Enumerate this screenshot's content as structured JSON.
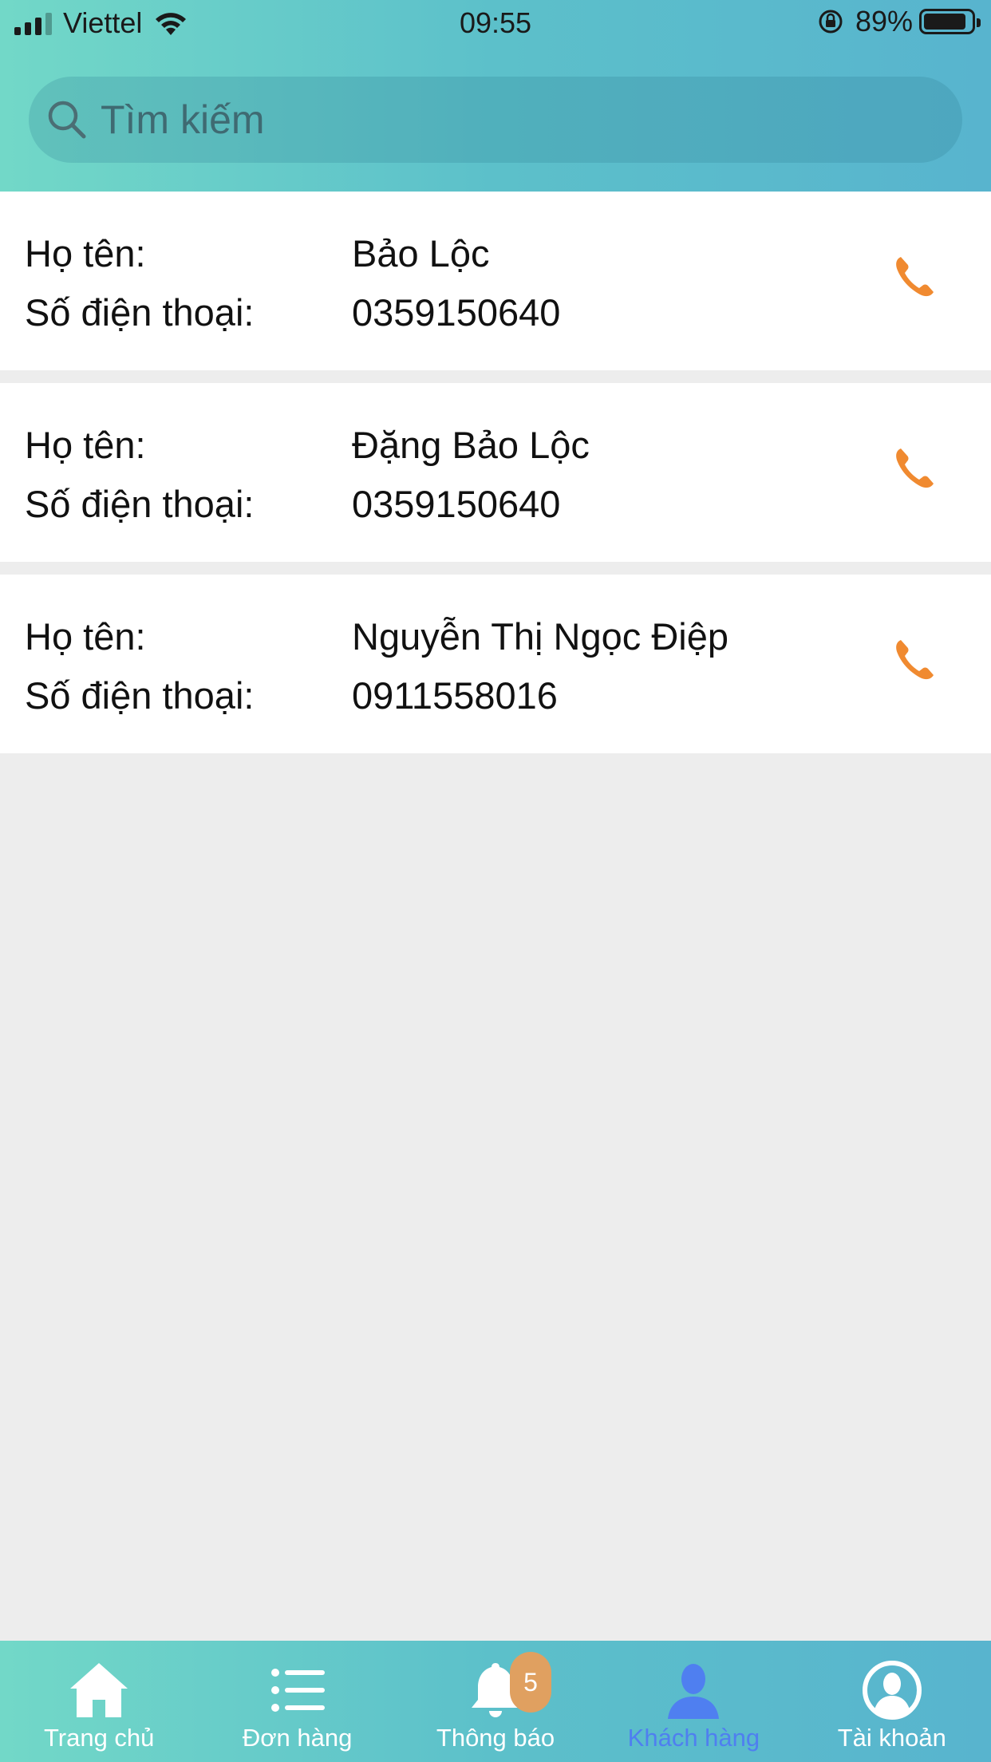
{
  "status_bar": {
    "carrier": "Viettel",
    "time": "09:55",
    "battery": "89%",
    "battery_level": 0.89
  },
  "search": {
    "placeholder": "Tìm kiếm",
    "value": ""
  },
  "customers": [
    {
      "name_label": "Họ tên:",
      "name": "Bảo Lộc",
      "phone_label": "Số điện thoại:",
      "phone": "0359150640"
    },
    {
      "name_label": "Họ tên:",
      "name": "Đặng Bảo Lộc",
      "phone_label": "Số điện thoại:",
      "phone": "0359150640"
    },
    {
      "name_label": "Họ tên:",
      "name": "Nguyễn Thị Ngọc Điệp",
      "phone_label": "Số điện thoại:",
      "phone": "0911558016"
    }
  ],
  "tabs": [
    {
      "label": "Trang chủ",
      "icon": "home-icon"
    },
    {
      "label": "Đơn hàng",
      "icon": "list-icon"
    },
    {
      "label": "Thông báo",
      "icon": "bell-icon",
      "badge": "5"
    },
    {
      "label": "Khách hàng",
      "icon": "person-icon",
      "active": true
    },
    {
      "label": "Tài khoản",
      "icon": "account-icon"
    }
  ],
  "colors": {
    "accent_active": "#4f7ff0",
    "call": "#f08a30",
    "badge": "#e0a060",
    "header_gradient_start": "#72d8c8",
    "header_gradient_end": "#58b4ce"
  }
}
